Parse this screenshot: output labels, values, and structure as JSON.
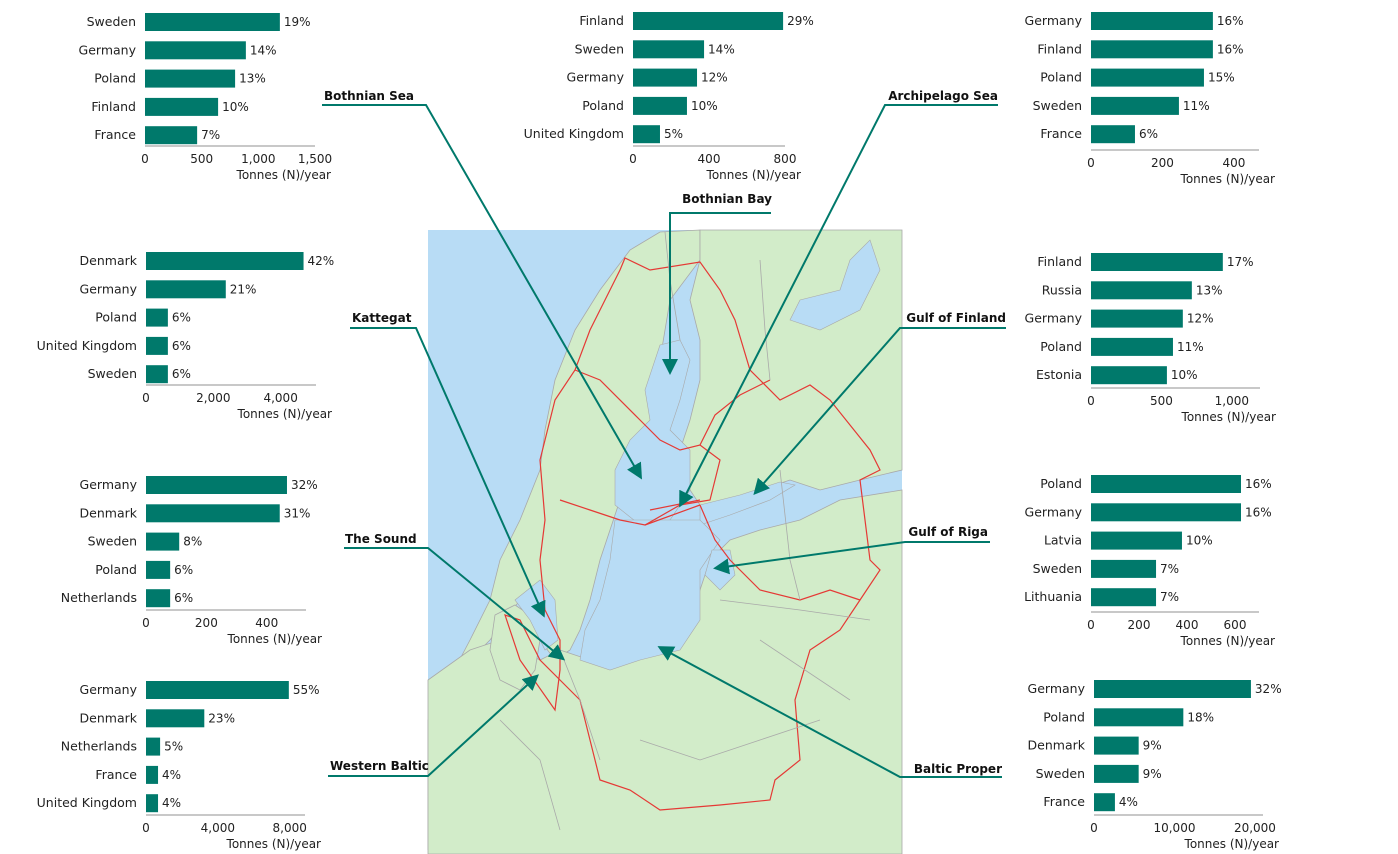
{
  "colors": {
    "bar": "#00796b",
    "leader": "#00796b",
    "axis": "#b5b5b5",
    "sea": "#b8dcf5",
    "land": "#d2ecc9",
    "catchment_border": "#e53935",
    "country_border": "#a9a9a9"
  },
  "chart_data": [
    {
      "id": "bothnian-sea",
      "type": "bar",
      "orientation": "horizontal",
      "region": "Bothnian Sea",
      "position": "top-left",
      "categories": [
        "Sweden",
        "Germany",
        "Poland",
        "Finland",
        "France"
      ],
      "values": [
        1190,
        890,
        795,
        645,
        460
      ],
      "value_labels": [
        "19%",
        "14%",
        "13%",
        "10%",
        "7%"
      ],
      "ticks": [
        0,
        500,
        1000,
        1500
      ],
      "tick_labels": [
        "0",
        "500",
        "1,000",
        "1,500"
      ],
      "xlim": [
        0,
        1500
      ],
      "xlabel": "Tonnes (N)/year"
    },
    {
      "id": "archipelago-sea",
      "type": "bar",
      "orientation": "horizontal",
      "region": "Archipelago Sea",
      "position": "top-center",
      "categories": [
        "Finland",
        "Sweden",
        "Germany",
        "Poland",
        "United Kingdom"
      ],
      "values": [
        790,
        374,
        337,
        284,
        142
      ],
      "value_labels": [
        "29%",
        "14%",
        "12%",
        "10%",
        "5%"
      ],
      "ticks": [
        0,
        400,
        800
      ],
      "tick_labels": [
        "0",
        "400",
        "800"
      ],
      "xlim": [
        0,
        800
      ],
      "xlabel": "Tonnes (N)/year"
    },
    {
      "id": "bothnian-bay",
      "type": "bar",
      "orientation": "horizontal",
      "region": "Bothnian Bay",
      "position": "top-right",
      "categories": [
        "Germany",
        "Finland",
        "Poland",
        "Sweden",
        "France"
      ],
      "values": [
        341,
        341,
        316,
        246,
        123
      ],
      "value_labels": [
        "16%",
        "16%",
        "15%",
        "11%",
        "6%"
      ],
      "ticks": [
        0,
        200,
        400
      ],
      "tick_labels": [
        "0",
        "200",
        "400"
      ],
      "xlim": [
        0,
        470
      ],
      "xlabel": "Tonnes (N)/year"
    },
    {
      "id": "kattegat",
      "type": "bar",
      "orientation": "horizontal",
      "region": "Kattegat",
      "position": "middle-left-upper",
      "categories": [
        "Denmark",
        "Germany",
        "Poland",
        "United Kingdom",
        "Sweden"
      ],
      "values": [
        4680,
        2370,
        650,
        650,
        650
      ],
      "value_labels": [
        "42%",
        "21%",
        "6%",
        "6%",
        "6%"
      ],
      "ticks": [
        0,
        2000,
        4000
      ],
      "tick_labels": [
        "0",
        "2,000",
        "4,000"
      ],
      "xlim": [
        0,
        5050
      ],
      "xlabel": "Tonnes (N)/year"
    },
    {
      "id": "gulf-of-finland",
      "type": "bar",
      "orientation": "horizontal",
      "region": "Gulf of Finland",
      "position": "middle-right-upper",
      "categories": [
        "Finland",
        "Russia",
        "Germany",
        "Poland",
        "Estonia"
      ],
      "values": [
        936,
        716,
        652,
        582,
        539
      ],
      "value_labels": [
        "17%",
        "13%",
        "12%",
        "11%",
        "10%"
      ],
      "ticks": [
        0,
        500,
        1000
      ],
      "tick_labels": [
        "0",
        "500",
        "1,000"
      ],
      "xlim": [
        0,
        1200
      ],
      "xlabel": "Tonnes (N)/year"
    },
    {
      "id": "the-sound",
      "type": "bar",
      "orientation": "horizontal",
      "region": "The Sound",
      "position": "middle-left-lower",
      "categories": [
        "Germany",
        "Denmark",
        "Sweden",
        "Poland",
        "Netherlands"
      ],
      "values": [
        467,
        443,
        110,
        80,
        80
      ],
      "value_labels": [
        "32%",
        "31%",
        "8%",
        "6%",
        "6%"
      ],
      "ticks": [
        0,
        200,
        400
      ],
      "tick_labels": [
        "0",
        "200",
        "400"
      ],
      "xlim": [
        0,
        530
      ],
      "xlabel": "Tonnes (N)/year"
    },
    {
      "id": "gulf-of-riga",
      "type": "bar",
      "orientation": "horizontal",
      "region": "Gulf of Riga",
      "position": "middle-right-lower",
      "categories": [
        "Poland",
        "Germany",
        "Latvia",
        "Sweden",
        "Lithuania"
      ],
      "values": [
        625,
        625,
        379,
        271,
        271
      ],
      "value_labels": [
        "16%",
        "16%",
        "10%",
        "7%",
        "7%"
      ],
      "ticks": [
        0,
        200,
        400,
        600
      ],
      "tick_labels": [
        "0",
        "200",
        "400",
        "600"
      ],
      "xlim": [
        0,
        700
      ],
      "xlabel": "Tonnes (N)/year"
    },
    {
      "id": "western-baltic",
      "type": "bar",
      "orientation": "horizontal",
      "region": "Western Baltic",
      "position": "bottom-left",
      "categories": [
        "Germany",
        "Denmark",
        "Netherlands",
        "France",
        "United Kingdom"
      ],
      "values": [
        7950,
        3245,
        785,
        670,
        670
      ],
      "value_labels": [
        "55%",
        "23%",
        "5%",
        "4%",
        "4%"
      ],
      "ticks": [
        0,
        4000,
        8000
      ],
      "tick_labels": [
        "0",
        "4,000",
        "8,000"
      ],
      "xlim": [
        0,
        8850
      ],
      "xlabel": "Tonnes (N)/year"
    },
    {
      "id": "baltic-proper",
      "type": "bar",
      "orientation": "horizontal",
      "region": "Baltic Proper",
      "position": "bottom-right",
      "categories": [
        "Germany",
        "Poland",
        "Denmark",
        "Sweden",
        "France"
      ],
      "values": [
        19500,
        11100,
        5550,
        5550,
        2600
      ],
      "value_labels": [
        "32%",
        "18%",
        "9%",
        "9%",
        "4%"
      ],
      "ticks": [
        0,
        10000,
        20000
      ],
      "tick_labels": [
        "0",
        "10,000",
        "20,000"
      ],
      "xlim": [
        0,
        21000
      ],
      "xlabel": "Tonnes (N)/year"
    }
  ],
  "map": {
    "region_labels": [
      "Bothnian Sea",
      "Bothnian Bay",
      "Archipelago Sea",
      "Kattegat",
      "Gulf of Finland",
      "The Sound",
      "Gulf of Riga",
      "Western Baltic",
      "Baltic Proper"
    ]
  }
}
